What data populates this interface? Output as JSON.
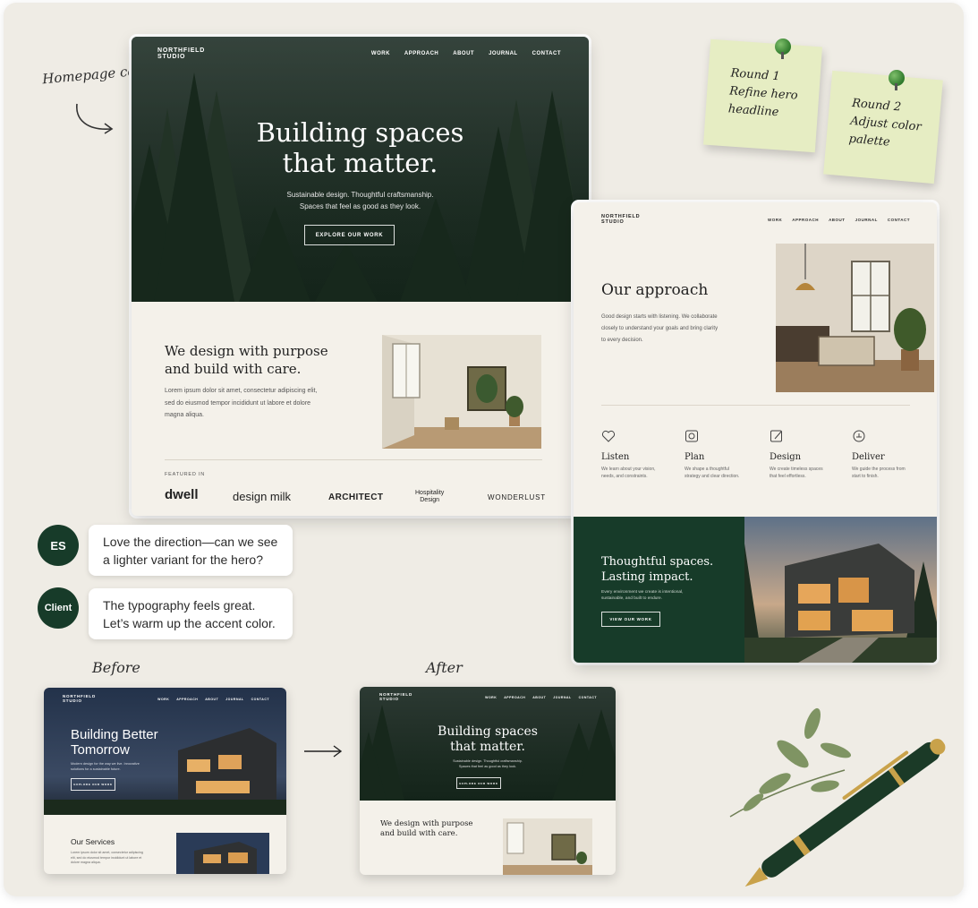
{
  "annotations": {
    "homepage_concept": "Homepage concept",
    "before": "Before",
    "after": "After"
  },
  "sticky_notes": [
    {
      "text": "Round 1\nRefine hero\nheadline"
    },
    {
      "text": "Round 2\nAdjust color\npalette"
    }
  ],
  "comments": [
    {
      "avatar": "ES",
      "text": "Love the direction—can we see a lighter variant for the hero?"
    },
    {
      "avatar": "Client",
      "text": "The typography feels great. Let’s warm up the accent color."
    }
  ],
  "main_mockup": {
    "brand": "NORTHFIELD\nSTUDIO",
    "nav": [
      "WORK",
      "APPROACH",
      "ABOUT",
      "JOURNAL",
      "CONTACT"
    ],
    "hero_title": "Building spaces\nthat matter.",
    "hero_subtitle": "Sustainable design. Thoughtful craftsmanship.\nSpaces that feel as good as they look.",
    "hero_button": "EXPLORE OUR WORK",
    "section_title": "We design with purpose\nand build with care.",
    "section_body": "Lorem ipsum dolor sit amet, consectetur adipiscing elit,\nsed do eiusmod tempor incididunt ut labore et dolore\nmagna aliqua.",
    "featured_label": "FEATURED IN",
    "featured_logos": [
      "dwell",
      "design milk",
      "ARCHITECT",
      "Hospitality\nDesign",
      "WONDERLUST"
    ]
  },
  "approach_mockup": {
    "brand": "NORTHFIELD\nSTUDIO",
    "nav": [
      "WORK",
      "APPROACH",
      "ABOUT",
      "JOURNAL",
      "CONTACT"
    ],
    "title": "Our approach",
    "body": "Good design starts with listening. We collaborate\nclosely to understand your goals and bring clarity\nto every decision.",
    "features": [
      {
        "icon": "heart-icon",
        "title": "Listen",
        "desc": "We learn about your vision,\nneeds, and constraints."
      },
      {
        "icon": "compass-icon",
        "title": "Plan",
        "desc": "We shape a thoughtful\nstrategy and clear direction."
      },
      {
        "icon": "pencil-icon",
        "title": "Design",
        "desc": "We create timeless spaces\nthat feel effortless."
      },
      {
        "icon": "deliver-icon",
        "title": "Deliver",
        "desc": "We guide the process from\nstart to finish."
      }
    ],
    "banner_title": "Thoughtful spaces.\nLasting impact.",
    "banner_body": "Every environment we create is intentional,\nsustainable, and built to endure.",
    "banner_button": "VIEW OUR WORK"
  },
  "before_mockup": {
    "brand": "NORTHFIELD\nSTUDIO",
    "nav": [
      "WORK",
      "APPROACH",
      "ABOUT",
      "JOURNAL",
      "CONTACT"
    ],
    "hero_title": "Building Better\nTomorrow",
    "hero_subtitle": "Modern design for the way we live. Innovative\nsolutions for a sustainable future.",
    "hero_button": "EXPLORE OUR WORK",
    "section_title": "Our Services",
    "section_body": "Lorem ipsum dolor sit amet, consectetur adipiscing\nelit, sed do eiusmod tempor incididunt ut labore et\ndolore magna aliqua."
  },
  "after_mockup": {
    "brand": "NORTHFIELD\nSTUDIO",
    "nav": [
      "WORK",
      "APPROACH",
      "ABOUT",
      "JOURNAL",
      "CONTACT"
    ],
    "hero_title": "Building spaces\nthat matter.",
    "hero_subtitle": "Sustainable design. Thoughtful craftsmanship.\nSpaces that feel as good as they look.",
    "hero_button": "EXPLORE OUR WORK",
    "section_title": "We design with purpose\nand build with care."
  },
  "colors": {
    "forest_green": "#173b29",
    "cream": "#f4f1ea",
    "board": "#efece5",
    "sticky": "#e6edc3"
  }
}
